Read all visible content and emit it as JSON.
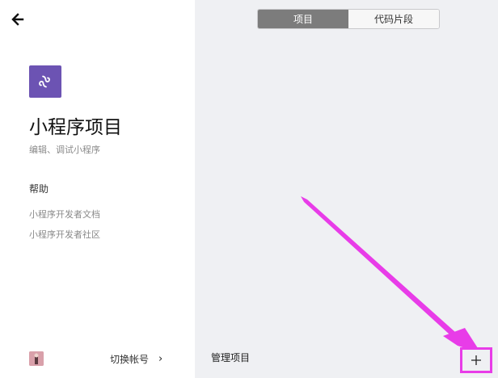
{
  "sidebar": {
    "app_title": "小程序项目",
    "app_subtitle": "编辑、调试小程序",
    "help_heading": "帮助",
    "help_links": [
      {
        "label": "小程序开发者文档"
      },
      {
        "label": "小程序开发者社区"
      }
    ],
    "switch_account_label": "切换帐号",
    "switch_account_chevron": "›"
  },
  "tabs": [
    {
      "label": "项目",
      "active": true
    },
    {
      "label": "代码片段",
      "active": false
    }
  ],
  "main": {
    "manage_projects_label": "管理项目",
    "add_label": "+"
  },
  "colors": {
    "logo_background": "#6c53b3",
    "panel_background": "#eff0f3",
    "active_tab": "#7c7c7c",
    "annotation": "#e83ce8"
  },
  "icons": {
    "back": "back-arrow-icon",
    "logo": "mini-program-logo-icon",
    "avatar": "user-avatar",
    "add": "plus-icon"
  }
}
